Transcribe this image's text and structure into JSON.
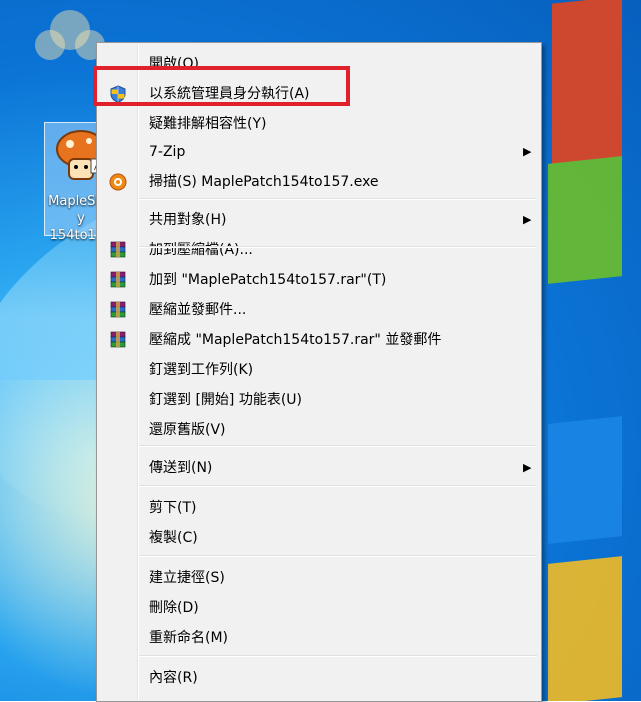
{
  "desktop": {
    "icon_label": "MapleStory\n154to157"
  },
  "menu": {
    "items": [
      {
        "label": "開啟(O)",
        "icon": ""
      },
      {
        "label": "以系統管理員身分執行(A)",
        "icon": "uac-shield-icon"
      },
      {
        "label": "疑難排解相容性(Y)",
        "icon": ""
      },
      {
        "label": "7-Zip",
        "icon": "",
        "submenu": true
      },
      {
        "label": "掃描(S) MaplePatch154to157.exe",
        "icon": "antivirus-icon"
      },
      {
        "label": "共用對象(H)",
        "icon": "",
        "submenu": true
      },
      {
        "label": "加到壓縮檔(A)...",
        "icon": "winrar-icon"
      },
      {
        "label": "加到 \"MaplePatch154to157.rar\"(T)",
        "icon": "winrar-icon"
      },
      {
        "label": "壓縮並發郵件...",
        "icon": "winrar-icon"
      },
      {
        "label": "壓縮成 \"MaplePatch154to157.rar\" 並發郵件",
        "icon": "winrar-icon"
      },
      {
        "label": "釘選到工作列(K)",
        "icon": ""
      },
      {
        "label": "釘選到 [開始] 功能表(U)",
        "icon": ""
      },
      {
        "label": "還原舊版(V)",
        "icon": ""
      },
      {
        "label": "傳送到(N)",
        "icon": "",
        "submenu": true
      },
      {
        "label": "剪下(T)",
        "icon": ""
      },
      {
        "label": "複製(C)",
        "icon": ""
      },
      {
        "label": "建立捷徑(S)",
        "icon": ""
      },
      {
        "label": "刪除(D)",
        "icon": ""
      },
      {
        "label": "重新命名(M)",
        "icon": ""
      },
      {
        "label": "內容(R)",
        "icon": ""
      }
    ],
    "submenu_arrow": "▶"
  },
  "colors": {
    "highlight_border": "#e0202a",
    "menu_bg": "#f1f1f1"
  }
}
